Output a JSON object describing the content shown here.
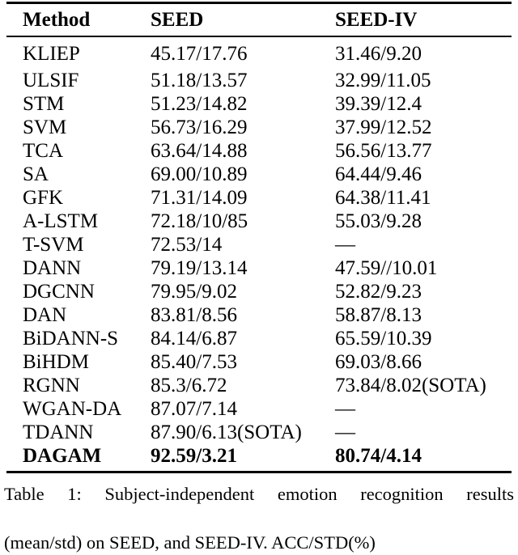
{
  "table": {
    "columns": [
      "Method",
      "SEED",
      "SEED-IV"
    ],
    "rows": [
      {
        "method": "KLIEP",
        "seed": "45.17/17.76",
        "seediv": "31.46/9.20",
        "bold": false
      },
      {
        "method": "ULSIF",
        "seed": "51.18/13.57",
        "seediv": "32.99/11.05",
        "bold": false
      },
      {
        "method": "STM",
        "seed": "51.23/14.82",
        "seediv": "39.39/12.4",
        "bold": false
      },
      {
        "method": "SVM",
        "seed": "56.73/16.29",
        "seediv": "37.99/12.52",
        "bold": false
      },
      {
        "method": "TCA",
        "seed": "63.64/14.88",
        "seediv": "56.56/13.77",
        "bold": false
      },
      {
        "method": "SA",
        "seed": "69.00/10.89",
        "seediv": "64.44/9.46",
        "bold": false
      },
      {
        "method": "GFK",
        "seed": "71.31/14.09",
        "seediv": "64.38/11.41",
        "bold": false
      },
      {
        "method": "A-LSTM",
        "seed": "72.18/10/85",
        "seediv": "55.03/9.28",
        "bold": false
      },
      {
        "method": "T-SVM",
        "seed": "72.53/14",
        "seediv": "—",
        "bold": false
      },
      {
        "method": "DANN",
        "seed": "79.19/13.14",
        "seediv": "47.59//10.01",
        "bold": false
      },
      {
        "method": "DGCNN",
        "seed": "79.95/9.02",
        "seediv": "52.82/9.23",
        "bold": false
      },
      {
        "method": "DAN",
        "seed": "83.81/8.56",
        "seediv": "58.87/8.13",
        "bold": false
      },
      {
        "method": "BiDANN-S",
        "seed": "84.14/6.87",
        "seediv": "65.59/10.39",
        "bold": false
      },
      {
        "method": "BiHDM",
        "seed": "85.40/7.53",
        "seediv": "69.03/8.66",
        "bold": false
      },
      {
        "method": "RGNN",
        "seed": "85.3/6.72",
        "seediv": "73.84/8.02(SOTA)",
        "bold": false
      },
      {
        "method": "WGAN-DA",
        "seed": "87.07/7.14",
        "seediv": "—",
        "bold": false
      },
      {
        "method": "TDANN",
        "seed": "87.90/6.13(SOTA)",
        "seediv": "—",
        "bold": false
      },
      {
        "method": "DAGAM",
        "seed": "92.59/3.21",
        "seediv": "80.74/4.14",
        "bold": true
      }
    ]
  },
  "caption": {
    "line1": "Table 1: Subject-independent emotion recognition results",
    "line2": "(mean/std) on SEED, and SEED-IV. ACC/STD(%)"
  }
}
